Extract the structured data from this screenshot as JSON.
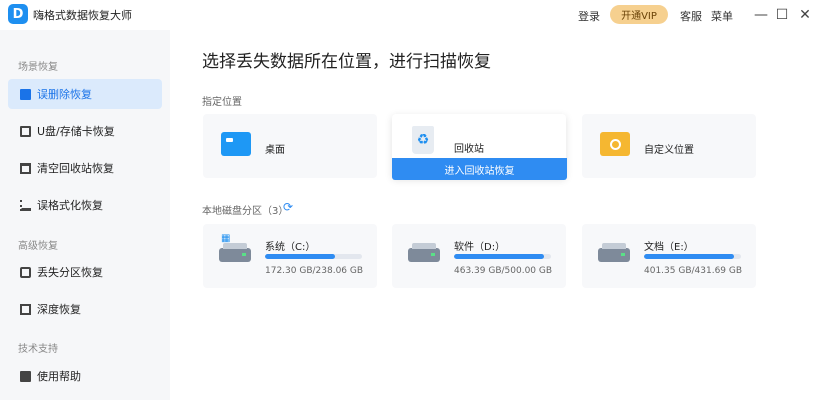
{
  "app": {
    "logo_letter": "D",
    "title": "嗨格式数据恢复大师"
  },
  "titlebar": {
    "login": "登录",
    "vip": "开通VIP",
    "service": "客服",
    "menu": "菜单"
  },
  "sidebar": {
    "sections": [
      {
        "title": "场景恢复",
        "items": [
          "误删除恢复",
          "U盘/存储卡恢复",
          "清空回收站恢复",
          "误格式化恢复"
        ]
      },
      {
        "title": "高级恢复",
        "items": [
          "丢失分区恢复",
          "深度恢复"
        ]
      },
      {
        "title": "技术支持",
        "items": [
          "使用帮助"
        ]
      }
    ],
    "active": "误删除恢复"
  },
  "main": {
    "title": "选择丢失数据所在位置，进行扫描恢复",
    "locations_label": "指定位置",
    "locations": [
      {
        "label": "桌面",
        "icon": "desktop-icon"
      },
      {
        "label": "回收站",
        "icon": "recycle-bin-icon",
        "action": "进入回收站恢复"
      },
      {
        "label": "自定义位置",
        "icon": "folder-search-icon"
      }
    ],
    "disks_label": "本地磁盘分区（3）",
    "disks": [
      {
        "name": "系统（C:）",
        "size": "172.30 GB/238.06 GB",
        "used_fraction": 0.72
      },
      {
        "name": "软件（D:）",
        "size": "463.39 GB/500.00 GB",
        "used_fraction": 0.93
      },
      {
        "name": "文档（E:）",
        "size": "401.35 GB/431.69 GB",
        "used_fraction": 0.93
      }
    ]
  },
  "colors": {
    "accent": "#2f8cf2",
    "vip": "#f6d08f",
    "sidebar_bg": "#f6f7f9",
    "active_bg": "#dbeafc"
  }
}
